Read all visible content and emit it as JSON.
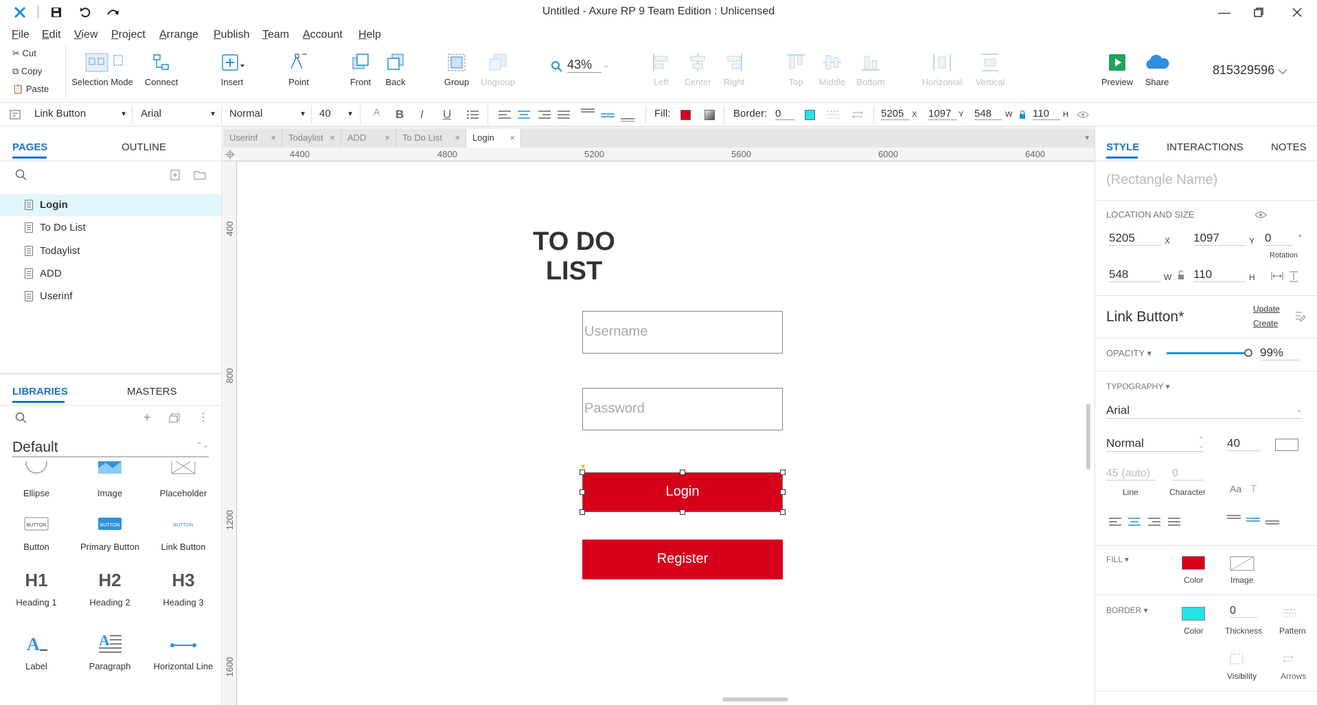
{
  "app": {
    "title": "Untitled - Axure RP 9 Team Edition : Unlicensed",
    "user_id": "815329596"
  },
  "menu": [
    "File",
    "Edit",
    "View",
    "Project",
    "Arrange",
    "Publish",
    "Team",
    "Account",
    "Help"
  ],
  "clipboard": {
    "cut": "Cut",
    "copy": "Copy",
    "paste": "Paste"
  },
  "toolbar": {
    "selection_mode": "Selection Mode",
    "connect": "Connect",
    "insert": "Insert",
    "point": "Point",
    "front": "Front",
    "back": "Back",
    "group": "Group",
    "ungroup": "Ungroup",
    "zoom": "43%",
    "left": "Left",
    "center": "Center",
    "right": "Right",
    "top": "Top",
    "middle": "Middle",
    "bottom": "Bottom",
    "horizontal": "Horizontal",
    "vertical": "Vertical",
    "preview": "Preview",
    "share": "Share"
  },
  "format": {
    "style": "Link Button",
    "font": "Arial",
    "weight": "Normal",
    "size": "40",
    "fill_label": "Fill:",
    "border_label": "Border:",
    "border_value": "0",
    "x": "5205",
    "x_label": "X",
    "y": "1097",
    "y_label": "Y",
    "w": "548",
    "w_label": "W",
    "h": "110",
    "h_label": "H",
    "fill_color": "#d7001b",
    "border_color": "#22e3e8"
  },
  "left": {
    "pages_tab": "PAGES",
    "outline_tab": "OUTLINE",
    "pages": [
      "Login",
      "To Do List",
      "Todaylist",
      "ADD",
      "Userinf"
    ],
    "libraries_tab": "LIBRARIES",
    "masters_tab": "MASTERS",
    "library": "Default",
    "widgets": [
      "Ellipse",
      "Image",
      "Placeholder",
      "Button",
      "Primary Button",
      "Link Button",
      "Heading 1",
      "Heading 2",
      "Heading 3",
      "Label",
      "Paragraph",
      "Horizontal Line"
    ],
    "widget_glyphs": {
      "h1": "H1",
      "h2": "H2",
      "h3": "H3",
      "button": "BUTTON"
    }
  },
  "tabs": [
    "Userinf",
    "Todaylist",
    "ADD",
    "To Do List",
    "Login"
  ],
  "ruler_h": [
    "4400",
    "4800",
    "5200",
    "5600",
    "6000",
    "6400"
  ],
  "ruler_v": [
    "400",
    "800",
    "1200",
    "1600"
  ],
  "canvas": {
    "heading": "TO DO LIST",
    "username_placeholder": "Username",
    "password_placeholder": "Password",
    "login": "Login",
    "register": "Register"
  },
  "right": {
    "style_tab": "STYLE",
    "interactions_tab": "INTERACTIONS",
    "notes_tab": "NOTES",
    "name_placeholder": "(Rectangle Name)",
    "location_size": "LOCATION AND SIZE",
    "x": "5205",
    "x_label": "X",
    "y": "1097",
    "y_label": "Y",
    "rotation": "0",
    "rotation_unit": "°",
    "rotation_label": "Rotation",
    "w": "548",
    "w_label": "W",
    "h": "110",
    "h_label": "H",
    "style_name": "Link Button*",
    "update": "Update",
    "create": "Create",
    "opacity_label": "OPACITY ▾",
    "opacity": "99%",
    "opacity_level": 0.99,
    "typography_label": "TYPOGRAPHY ▾",
    "font": "Arial",
    "weight": "Normal",
    "size": "40",
    "line": "45 (auto)",
    "line_label": "Line",
    "character": "0",
    "character_label": "Character",
    "fill_label": "FILL ▾",
    "color_label": "Color",
    "image_label": "Image",
    "border_label": "BORDER ▾",
    "border_color_label": "Color",
    "thickness": "0",
    "thickness_label": "Thickness",
    "pattern_label": "Pattern",
    "visibility_label": "Visibility",
    "arrows_label": "Arrows"
  }
}
